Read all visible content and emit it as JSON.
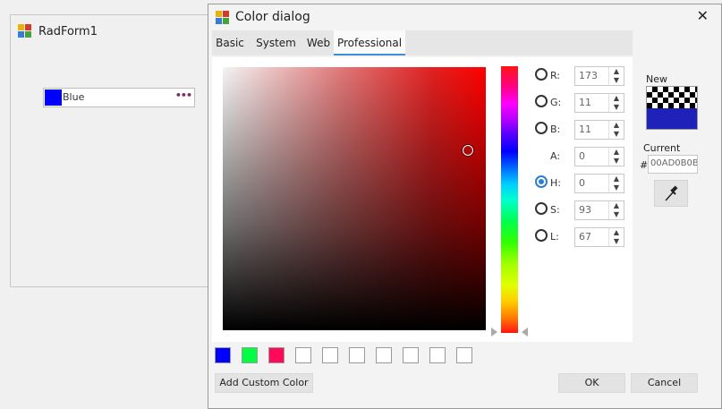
{
  "background_form": {
    "title": "RadForm1",
    "color_editor": {
      "color_name": "Blue",
      "swatch_color": "#0000ff",
      "ellipsis": "•••"
    }
  },
  "dialog": {
    "title": "Color dialog",
    "close_glyph": "✕",
    "tabs": [
      {
        "label": "Basic",
        "active": false
      },
      {
        "label": "System",
        "active": false
      },
      {
        "label": "Web",
        "active": false
      },
      {
        "label": "Professional",
        "active": true
      }
    ],
    "channels": [
      {
        "label": "R:",
        "value": "173",
        "radio": true,
        "checked": false
      },
      {
        "label": "G:",
        "value": "11",
        "radio": true,
        "checked": false
      },
      {
        "label": "B:",
        "value": "11",
        "radio": true,
        "checked": false
      },
      {
        "label": "A:",
        "value": "0",
        "radio": false,
        "checked": false
      },
      {
        "label": "H:",
        "value": "0",
        "radio": true,
        "checked": true
      },
      {
        "label": "S:",
        "value": "93",
        "radio": true,
        "checked": false
      },
      {
        "label": "L:",
        "value": "67",
        "radio": true,
        "checked": false
      }
    ],
    "new_label": "New",
    "current_label": "Current",
    "hash": "#",
    "hex_value": "00AD0B0B",
    "new_color": "#1f22b8",
    "custom_colors": [
      "#0000ff",
      "#00ff40",
      "#ff0a5a",
      "#ffffff",
      "#ffffff",
      "#ffffff",
      "#ffffff",
      "#ffffff",
      "#ffffff",
      "#ffffff"
    ],
    "buttons": {
      "add_custom": "Add Custom Color",
      "ok": "OK",
      "cancel": "Cancel"
    }
  }
}
